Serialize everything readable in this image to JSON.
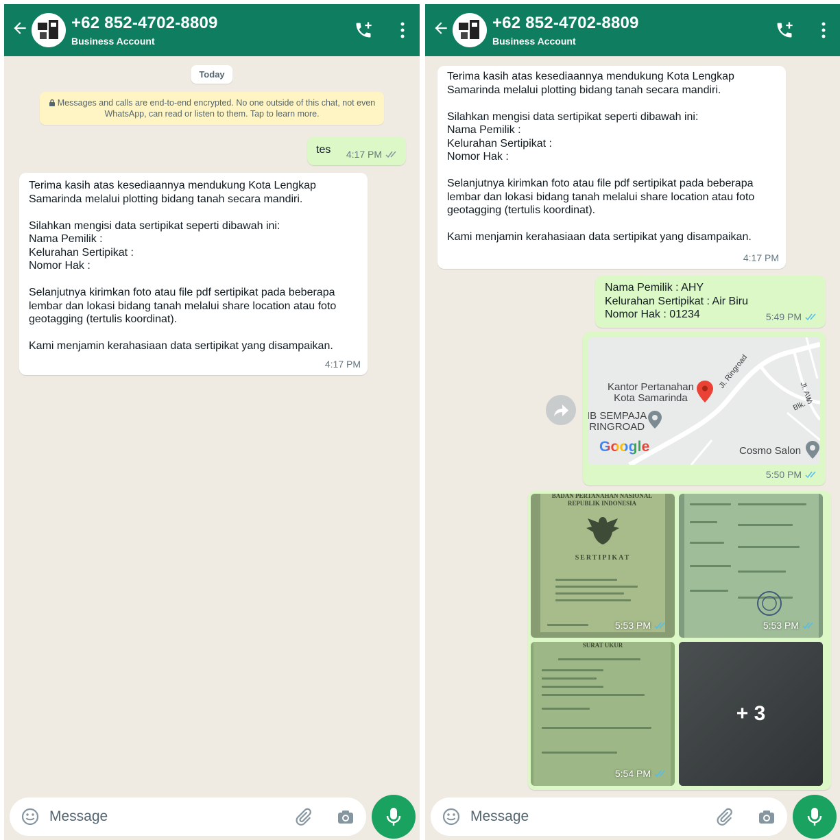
{
  "colors": {
    "header": "#0f7d5f",
    "chat_bg": "#efeae2",
    "incoming": "#ffffff",
    "outgoing": "#dcf8c6",
    "encryption_note": "#fff5c4",
    "read_tick": "#53bdeb",
    "mic_button": "#1aa260"
  },
  "icons": [
    "back-arrow-icon",
    "add-call-icon",
    "more-vert-icon",
    "lock-icon",
    "double-check-icon",
    "forward-icon",
    "map-pin-icon",
    "emoji-icon",
    "attach-icon",
    "camera-icon",
    "mic-icon"
  ],
  "contact": {
    "phone": "+62 852-4702-8809",
    "subtitle": "Business Account"
  },
  "left": {
    "date_chip": "Today",
    "encryption_note": "Messages and calls are end-to-end encrypted. No one outside of this chat, not even WhatsApp, can read or listen to them. Tap to learn more.",
    "messages": [
      {
        "direction": "out",
        "text": "tes",
        "time": "4:17 PM",
        "status": "delivered"
      },
      {
        "direction": "in",
        "text": "Terima kasih atas kesediaannya mendukung Kota Lengkap Samarinda melalui plotting bidang tanah secara mandiri.\n\nSilahkan mengisi data sertipikat seperti dibawah ini:\nNama Pemilik :\nKelurahan Sertipikat :\nNomor Hak :\n\nSelanjutnya kirimkan foto atau file pdf sertipikat pada beberapa lembar dan lokasi bidang tanah melalui share location atau foto geotagging (tertulis koordinat).\n\nKami menjamin kerahasiaan data sertipikat yang disampaikan.",
        "time": "4:17 PM"
      }
    ]
  },
  "right": {
    "messages": [
      {
        "direction": "in",
        "text": "Terima kasih atas kesediaannya mendukung Kota Lengkap Samarinda melalui plotting bidang tanah secara mandiri.\n\nSilahkan mengisi data sertipikat seperti dibawah ini:\nNama Pemilik :\nKelurahan Sertipikat :\nNomor Hak :\n\nSelanjutnya kirimkan foto atau file pdf sertipikat pada beberapa lembar dan lokasi bidang tanah melalui share location atau foto geotagging (tertulis koordinat).\n\nKami menjamin kerahasiaan data sertipikat yang disampaikan.",
        "time": "4:17 PM"
      },
      {
        "direction": "out",
        "text": "Nama Pemilik : AHY\nKelurahan Sertipikat : Air Biru\nNomor Hak : 01234",
        "time": "5:49 PM",
        "status": "read"
      },
      {
        "direction": "out",
        "type": "location",
        "time": "5:50 PM",
        "status": "read"
      }
    ],
    "map": {
      "place": "Kantor Pertanahan\nKota Samarinda",
      "poi_1": "IB SEMPAJA\nRINGROAD",
      "poi_2": "Cosmo Salon",
      "road": "Jl. Ringroad",
      "road_2": "Jl. AW",
      "block": "Blk. S",
      "brand": "Google"
    },
    "album": {
      "photos": [
        {
          "time": "5:53 PM",
          "status": "read",
          "doc_header": "BADAN PERTANAHAN NASIONAL\nREPUBLIK INDONESIA",
          "doc_title": "SERTIPIKAT"
        },
        {
          "time": "5:53 PM",
          "status": "read"
        },
        {
          "time": "5:54 PM",
          "status": "read",
          "doc_title": "SURAT UKUR"
        }
      ],
      "more_count": "+ 3"
    }
  },
  "input": {
    "placeholder": "Message"
  }
}
